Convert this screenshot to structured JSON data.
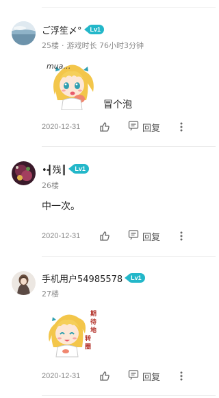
{
  "comments": [
    {
      "username": "ご浮笙〆°",
      "level": "Lv1",
      "floor": "25楼",
      "play_time": "游戏时长 76小时3分钟",
      "sticker_text": "mua…",
      "text": "冒个泡",
      "date": "2020-12-31",
      "reply_label": "回复"
    },
    {
      "username": "•┫残║",
      "level": "Lv1",
      "floor": "26楼",
      "text": "中一次。",
      "date": "2020-12-31",
      "reply_label": "回复"
    },
    {
      "username": "手机用户54985578",
      "level": "Lv1",
      "floor": "27楼",
      "sticker_text": "期待地转圈",
      "date": "2020-12-31",
      "reply_label": "回复"
    }
  ],
  "colors": {
    "level_badge": "#23b7c9",
    "meta_text": "#8a8a8a",
    "divider": "#ececec",
    "hair": "#f3c64a",
    "eyes": "#2f9fb0"
  },
  "icons": [
    "thumbs-up-icon",
    "comment-reply-icon",
    "more-vertical-icon"
  ]
}
